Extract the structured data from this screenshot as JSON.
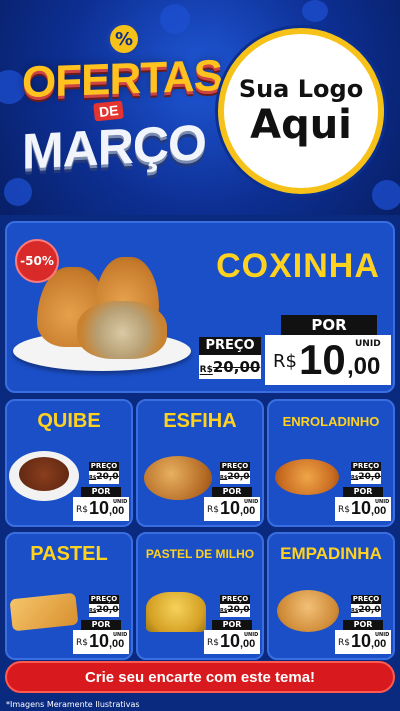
{
  "header": {
    "badge_symbol": "%",
    "title_line1": "OFERTAS",
    "title_de": "DE",
    "title_line2": "MARÇO",
    "logo_line1": "Sua Logo",
    "logo_line2": "Aqui"
  },
  "featured": {
    "discount": "-50%",
    "name": "COXINHA",
    "preco_label": "PREÇO",
    "old_currency": "R$",
    "old_price": "20,00",
    "por_label": "POR",
    "currency": "R$",
    "price_int": "10",
    "price_dec": ",00",
    "unit": "UNID"
  },
  "products": [
    {
      "name": "QUIBE",
      "preco_label": "PREÇO",
      "old_currency": "R$",
      "old_price": "20,00",
      "por_label": "POR",
      "currency": "R$",
      "price_int": "10",
      "price_dec": ",00",
      "unit": "UNID"
    },
    {
      "name": "ESFIHA",
      "preco_label": "PREÇO",
      "old_currency": "R$",
      "old_price": "20,00",
      "por_label": "POR",
      "currency": "R$",
      "price_int": "10",
      "price_dec": ",00",
      "unit": "UNID"
    },
    {
      "name": "ENROLADINHO",
      "preco_label": "PREÇO",
      "old_currency": "R$",
      "old_price": "20,00",
      "por_label": "POR",
      "currency": "R$",
      "price_int": "10",
      "price_dec": ",00",
      "unit": "UNID"
    },
    {
      "name": "PASTEL",
      "preco_label": "PREÇO",
      "old_currency": "R$",
      "old_price": "20,00",
      "por_label": "POR",
      "currency": "R$",
      "price_int": "10",
      "price_dec": ",00",
      "unit": "UNID"
    },
    {
      "name": "PASTEL DE MILHO",
      "preco_label": "PREÇO",
      "old_currency": "R$",
      "old_price": "20,00",
      "por_label": "POR",
      "currency": "R$",
      "price_int": "10",
      "price_dec": ",00",
      "unit": "UNID"
    },
    {
      "name": "EMPADINHA",
      "preco_label": "PREÇO",
      "old_currency": "R$",
      "old_price": "20,00",
      "por_label": "POR",
      "currency": "R$",
      "price_int": "10",
      "price_dec": ",00",
      "unit": "UNID"
    }
  ],
  "cta": "Crie seu encarte com este tema!",
  "disclaimer": "*Imagens Meramente Ilustrativas",
  "colors": {
    "accent_yellow": "#ffd21f",
    "card_blue": "#1b4fc8",
    "cta_red": "#d8191d"
  }
}
